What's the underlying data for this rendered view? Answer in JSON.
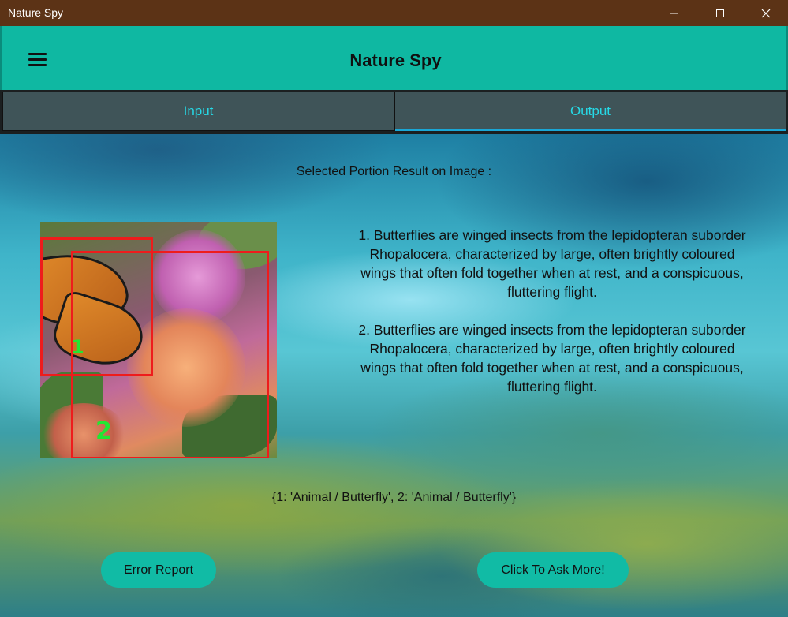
{
  "window": {
    "title": "Nature Spy",
    "controls": {
      "minimize_icon": "minimize-icon",
      "maximize_icon": "maximize-icon",
      "close_icon": "close-icon"
    }
  },
  "appbar": {
    "title": "Nature Spy",
    "menu_icon": "hamburger-menu-icon"
  },
  "tabs": [
    {
      "label": "Input",
      "active": false
    },
    {
      "label": "Output",
      "active": true
    }
  ],
  "result": {
    "heading": "Selected Portion Result on Image :",
    "box_labels": [
      "1",
      "2"
    ],
    "descriptions": [
      "1. Butterflies are winged insects from the lepidopteran suborder Rhopalocera, characterized by large, often brightly coloured wings that often fold together when at rest, and a conspicuous, fluttering flight.",
      "2. Butterflies are winged insects from the lepidopteran suborder Rhopalocera, characterized by large, often brightly coloured wings that often fold together when at rest, and a conspicuous, fluttering flight."
    ],
    "summary": "{1: 'Animal / Butterfly', 2: 'Animal / Butterfly'}"
  },
  "buttons": {
    "error_report": "Error Report",
    "ask_more": "Click To Ask More!"
  },
  "colors": {
    "titlebar": "#5c3316",
    "accent": "#0fb8a2",
    "tab_text": "#26d9e6",
    "tab_bg": "#3f5458",
    "box_outline": "#ee1c1c",
    "box_label": "#22e632"
  }
}
